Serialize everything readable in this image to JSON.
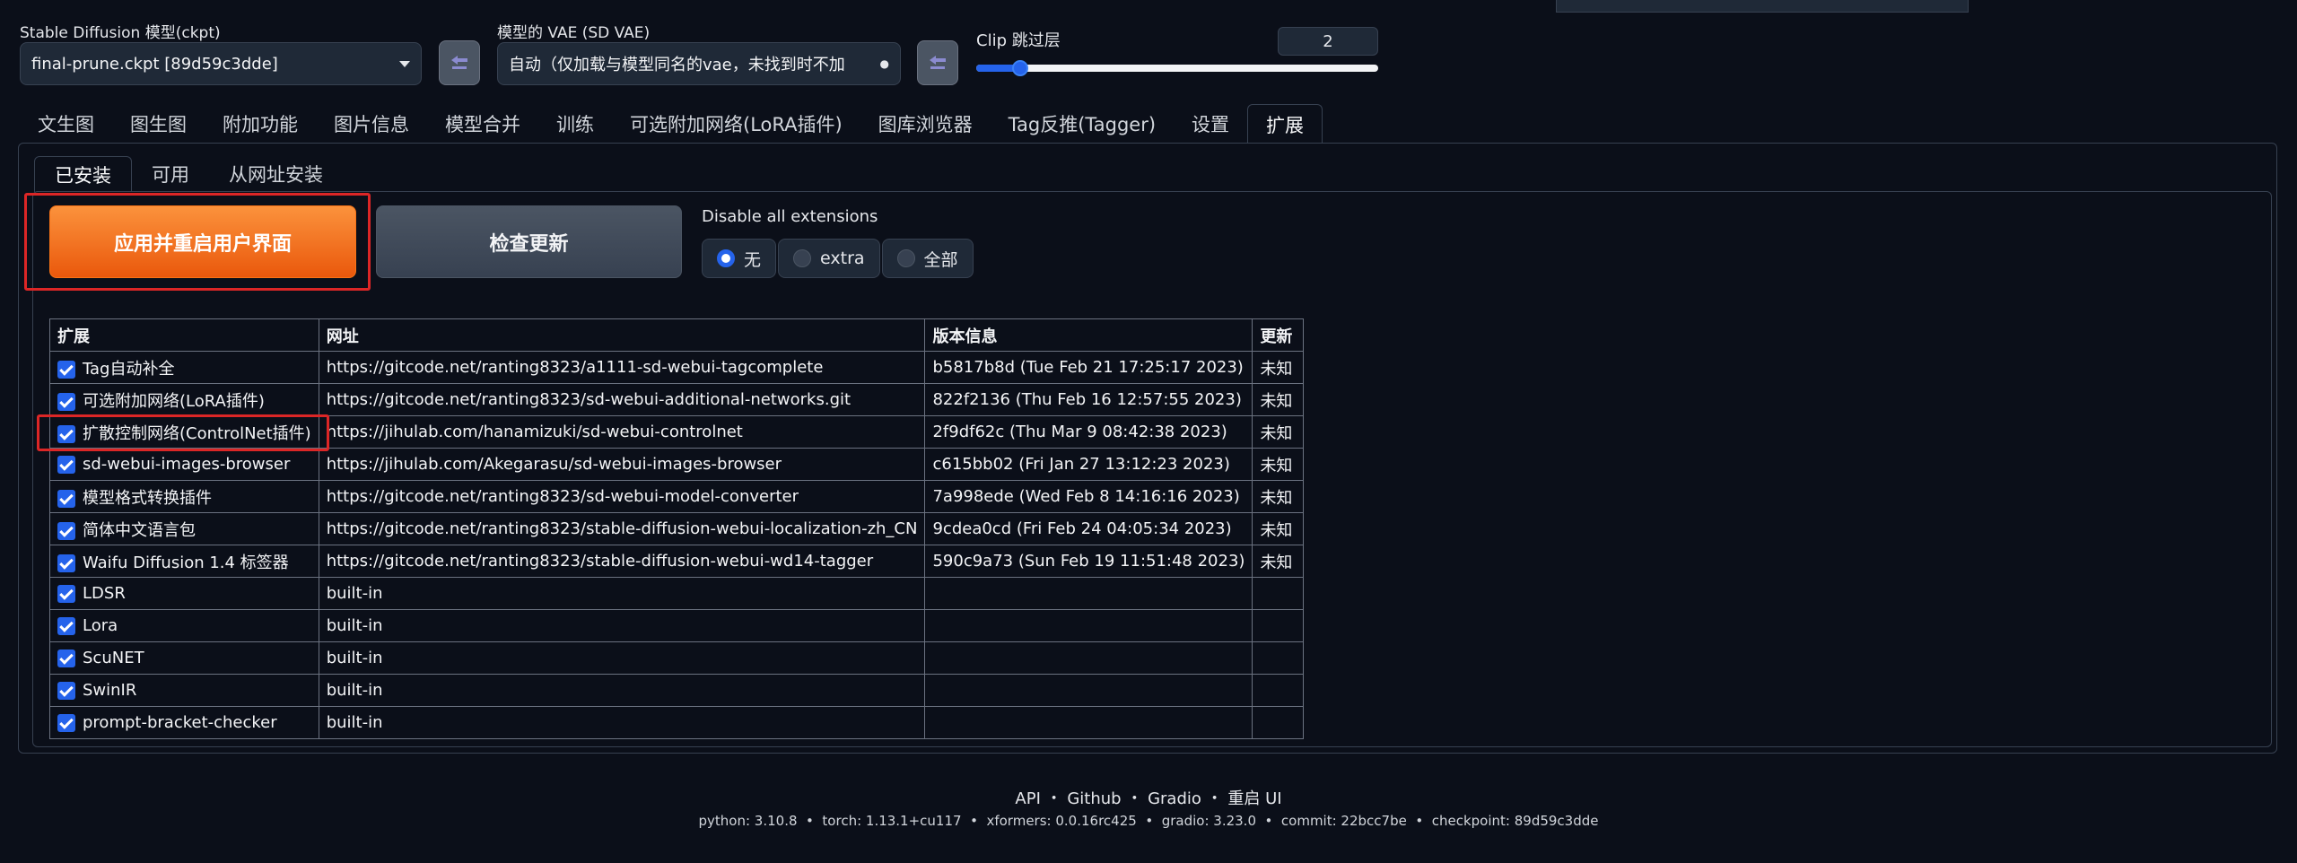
{
  "header": {
    "ckpt_label": "Stable Diffusion 模型(ckpt)",
    "ckpt_value": "final-prune.ckpt [89d59c3dde]",
    "vae_label": "模型的 VAE (SD VAE)",
    "vae_value": "自动（仅加载与模型同名的vae，未找到时不加",
    "clip_label": "Clip 跳过层",
    "clip_value": "2",
    "clip_fraction": 0.05
  },
  "tabs": [
    "文生图",
    "图生图",
    "附加功能",
    "图片信息",
    "模型合并",
    "训练",
    "可选附加网络(LoRA插件)",
    "图库浏览器",
    "Tag反推(Tagger)",
    "设置",
    "扩展"
  ],
  "subtabs": [
    "已安装",
    "可用",
    "从网址安装"
  ],
  "buttons": {
    "apply_restart": "应用并重启用户界面",
    "check_updates": "检查更新"
  },
  "disable": {
    "label": "Disable all extensions",
    "options": [
      "无",
      "extra",
      "全部"
    ],
    "selected": "无"
  },
  "table": {
    "headers": [
      "扩展",
      "网址",
      "版本信息",
      "更新"
    ],
    "rows": [
      {
        "name": "Tag自动补全",
        "url": "https://gitcode.net/ranting8323/a1111-sd-webui-tagcomplete",
        "version": "b5817b8d (Tue Feb 21 17:25:17 2023)",
        "update": "未知"
      },
      {
        "name": "可选附加网络(LoRA插件)",
        "url": "https://gitcode.net/ranting8323/sd-webui-additional-networks.git",
        "version": "822f2136 (Thu Feb 16 12:57:55 2023)",
        "update": "未知"
      },
      {
        "name": "扩散控制网络(ControlNet插件)",
        "url": "https://jihulab.com/hanamizuki/sd-webui-controlnet",
        "version": "2f9df62c (Thu Mar 9 08:42:38 2023)",
        "update": "未知"
      },
      {
        "name": "sd-webui-images-browser",
        "url": "https://jihulab.com/Akegarasu/sd-webui-images-browser",
        "version": "c615bb02 (Fri Jan 27 13:12:23 2023)",
        "update": "未知"
      },
      {
        "name": "模型格式转换插件",
        "url": "https://gitcode.net/ranting8323/sd-webui-model-converter",
        "version": "7a998ede (Wed Feb 8 14:16:16 2023)",
        "update": "未知"
      },
      {
        "name": "简体中文语言包",
        "url": "https://gitcode.net/ranting8323/stable-diffusion-webui-localization-zh_CN",
        "version": "9cdea0cd (Fri Feb 24 04:05:34 2023)",
        "update": "未知"
      },
      {
        "name": "Waifu Diffusion 1.4 标签器",
        "url": "https://gitcode.net/ranting8323/stable-diffusion-webui-wd14-tagger",
        "version": "590c9a73 (Sun Feb 19 11:51:48 2023)",
        "update": "未知"
      },
      {
        "name": "LDSR",
        "url": "built-in",
        "version": "",
        "update": ""
      },
      {
        "name": "Lora",
        "url": "built-in",
        "version": "",
        "update": ""
      },
      {
        "name": "ScuNET",
        "url": "built-in",
        "version": "",
        "update": ""
      },
      {
        "name": "SwinIR",
        "url": "built-in",
        "version": "",
        "update": ""
      },
      {
        "name": "prompt-bracket-checker",
        "url": "built-in",
        "version": "",
        "update": ""
      }
    ]
  },
  "footer": {
    "links": [
      "API",
      "Github",
      "Gradio",
      "重启 UI"
    ],
    "separator": "・",
    "versions": "python: 3.10.8  •  torch: 1.13.1+cu117  •  xformers: 0.0.16rc425  •  gradio: 3.23.0  •  commit: 22bcc7be  •  checkpoint: 89d59c3dde"
  },
  "colors": {
    "background": "#0b0f19",
    "primary_button": "#ea580c",
    "accent": "#2563eb",
    "highlight_box": "#dc2626"
  },
  "icons": {
    "refresh": "refresh-icon",
    "dropdown": "chevron-down-icon"
  }
}
